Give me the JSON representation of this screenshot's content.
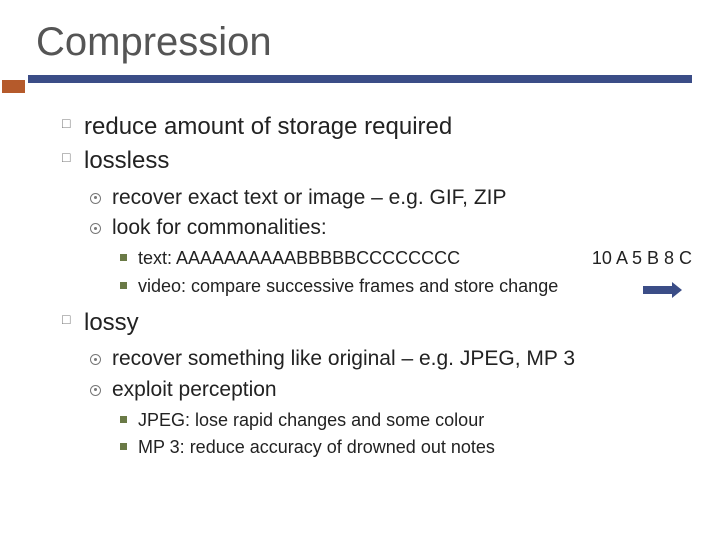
{
  "title": "Compression",
  "bullets": {
    "b1": "reduce amount of storage required",
    "b2": "lossless",
    "b2_sub": {
      "s1": "recover exact text or image – e.g. GIF, ZIP",
      "s2": "look for commonalities:",
      "s2_sub": {
        "t1_left": "text: AAAAAAAAAABBBBBCCCCCCCC",
        "t1_right": "10 A 5 B 8 C",
        "t2": "video:  compare successive frames and store change"
      }
    },
    "b3": "lossy",
    "b3_sub": {
      "s1": "recover something like original – e.g. JPEG, MP 3",
      "s2": "exploit perception",
      "s2_sub": {
        "t1": "JPEG: lose rapid changes and some colour",
        "t2": "MP 3: reduce accuracy of drowned out notes"
      }
    }
  }
}
